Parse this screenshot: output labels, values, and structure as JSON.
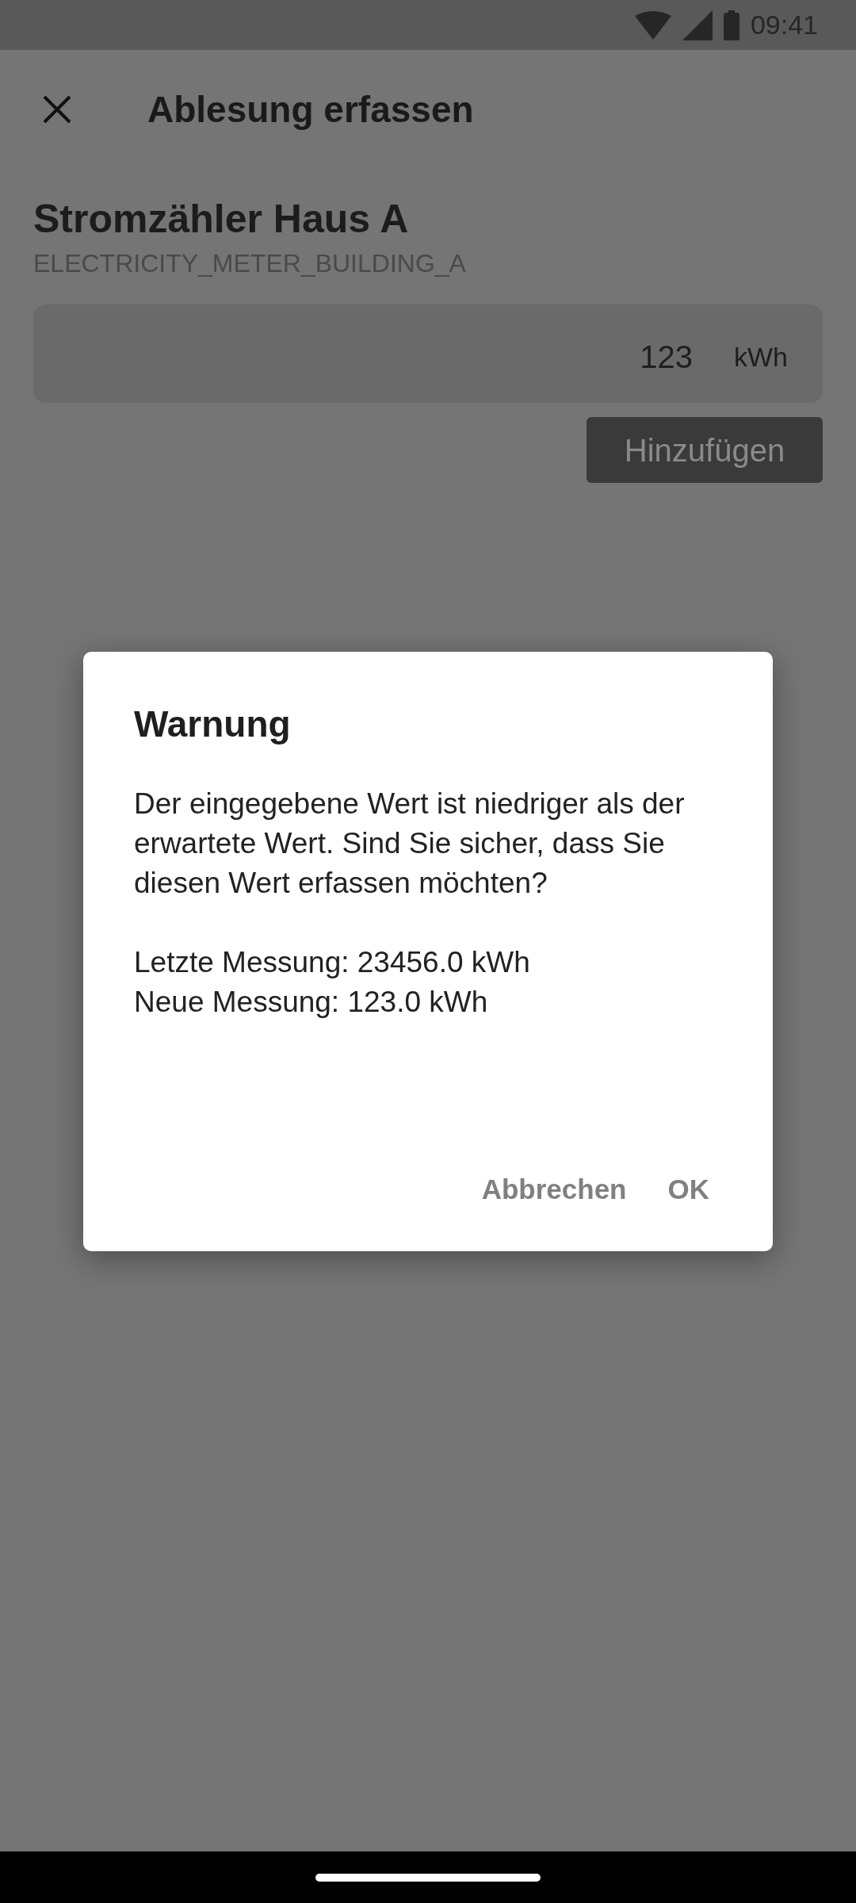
{
  "status_bar": {
    "time": "09:41"
  },
  "app_bar": {
    "title": "Ablesung erfassen"
  },
  "meter": {
    "name": "Stromzähler Haus A",
    "id": "ELECTRICITY_METER_BUILDING_A"
  },
  "reading_field": {
    "value": "123",
    "unit": "kWh"
  },
  "add_button": {
    "label": "Hinzufügen",
    "disabled": true
  },
  "dialog": {
    "title": "Warnung",
    "message": "Der eingegebene Wert ist niedriger als der erwartete Wert. Sind Sie sicher, dass Sie diesen Wert erfassen möchten?",
    "details": [
      "Letzte Messung: 23456.0 kWh",
      "Neue Messung: 123.0 kWh"
    ],
    "actions": [
      "Abbrechen",
      "OK"
    ]
  }
}
